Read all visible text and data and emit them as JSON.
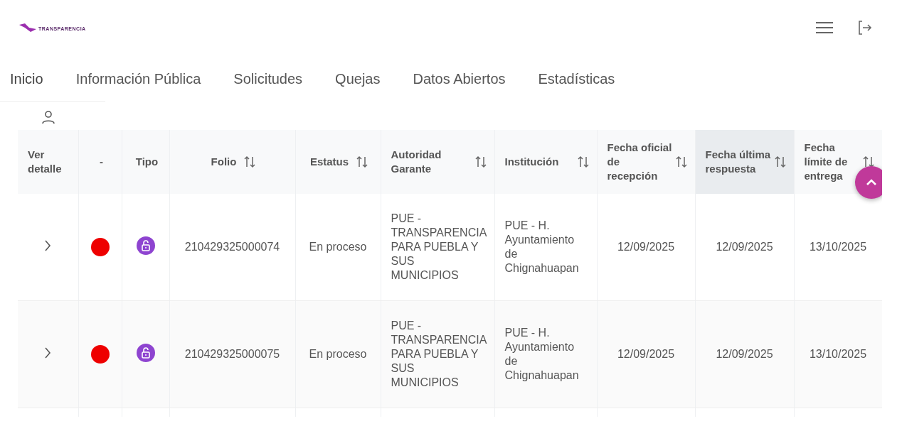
{
  "header": {
    "logo_text": "TRANSPARENCIA"
  },
  "nav": [
    {
      "label": "Inicio",
      "selected": true
    },
    {
      "label": "Información Pública",
      "selected": false
    },
    {
      "label": "Solicitudes",
      "selected": false
    },
    {
      "label": "Quejas",
      "selected": false
    },
    {
      "label": "Datos Abiertos",
      "selected": false
    },
    {
      "label": "Estadísticas",
      "selected": false
    }
  ],
  "table": {
    "columns": [
      {
        "label": "Ver detalle",
        "sortable": false,
        "selected": false
      },
      {
        "label": "-",
        "sortable": false,
        "selected": false
      },
      {
        "label": "Tipo",
        "sortable": false,
        "selected": false
      },
      {
        "label": "Folio",
        "sortable": true,
        "selected": false
      },
      {
        "label": "Estatus",
        "sortable": true,
        "selected": false
      },
      {
        "label": "Autoridad Garante",
        "sortable": true,
        "selected": false
      },
      {
        "label": "Institución",
        "sortable": true,
        "selected": false
      },
      {
        "label": "Fecha oficial de recepción",
        "sortable": true,
        "selected": false
      },
      {
        "label": "Fecha última respuesta",
        "sortable": true,
        "selected": true
      },
      {
        "label": "Fecha límite de entrega",
        "sortable": true,
        "selected": false
      }
    ],
    "rows": [
      {
        "color": "#ee0000",
        "folio": "210429325000074",
        "estatus": "En proceso",
        "autoridad": "PUE - TRANSPARENCIA PARA PUEBLA Y SUS MUNICIPIOS",
        "institucion": "PUE - H. Ayuntamiento de Chignahuapan",
        "recepcion": "12/09/2025",
        "respuesta": "12/09/2025",
        "limite": "13/10/2025"
      },
      {
        "color": "#ee0000",
        "folio": "210429325000075",
        "estatus": "En proceso",
        "autoridad": "PUE - TRANSPARENCIA PARA PUEBLA Y SUS MUNICIPIOS",
        "institucion": "PUE - H. Ayuntamiento de Chignahuapan",
        "recepcion": "12/09/2025",
        "respuesta": "12/09/2025",
        "limite": "13/10/2025"
      }
    ]
  }
}
